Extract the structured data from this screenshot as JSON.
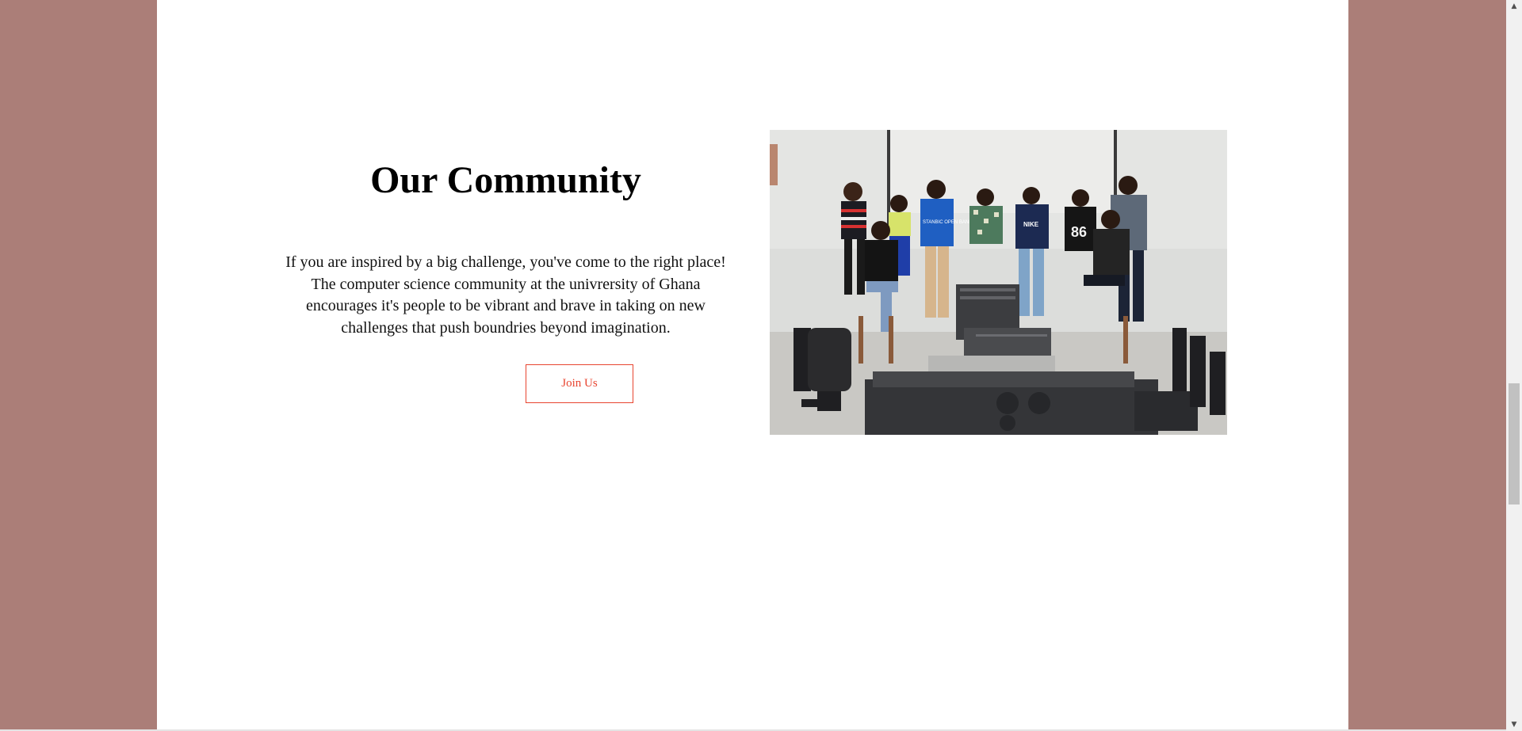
{
  "community": {
    "title": "Our Community",
    "body": "If you are inspired by a big challenge, you've come to the right place! The computer science community at the univrersity of Ghana encourages it's people to be vibrant and brave in taking on new challenges that push boundries beyond imagination.",
    "join_label": "Join Us"
  },
  "photo": {
    "shirt_text": "STANBIC OPEN BANKING",
    "brand_text": "NIKE",
    "jersey_number": "86"
  },
  "scrollbar": {
    "up_icon": "▲",
    "down_icon": "▼",
    "position_fraction": 0.52
  },
  "colors": {
    "page_background": "#ab7e78",
    "content_background": "#ffffff",
    "accent": "#e8442f"
  }
}
